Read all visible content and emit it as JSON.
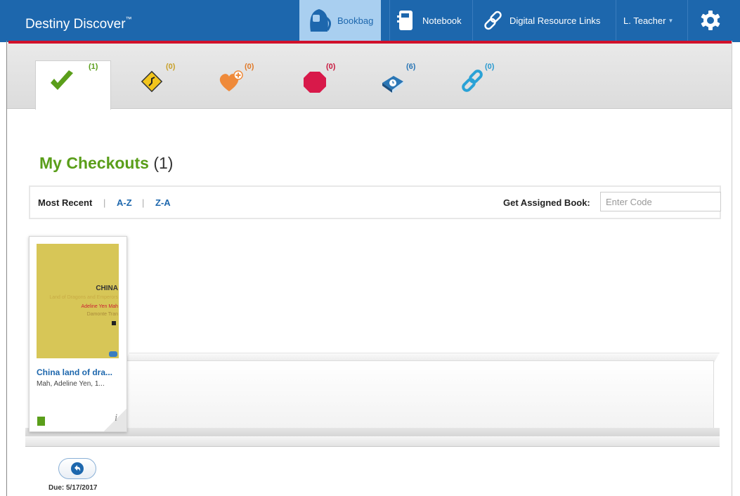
{
  "app": {
    "brand": "Destiny Discover",
    "tm": "™"
  },
  "nav": {
    "bookbag": "Bookbag",
    "notebook": "Notebook",
    "resource_links": "Digital Resource Links",
    "user": "L. Teacher"
  },
  "tabs": [
    {
      "icon": "checkmark-icon",
      "count": "(1)",
      "color": "#5a9e1a"
    },
    {
      "icon": "road-sign-icon",
      "count": "(0)",
      "color": "#c8a12a"
    },
    {
      "icon": "heart-plus-icon",
      "count": "(0)",
      "color": "#e07a2a"
    },
    {
      "icon": "stop-sign-icon",
      "count": "(0)",
      "color": "#c8193f"
    },
    {
      "icon": "book-clock-icon",
      "count": "(6)",
      "color": "#2a76b5"
    },
    {
      "icon": "link-icon",
      "count": "(0)",
      "color": "#2a9ad0"
    }
  ],
  "page": {
    "title": "My Checkouts",
    "count": "(1)"
  },
  "sort": {
    "most_recent": "Most Recent",
    "az": "A-Z",
    "za": "Z-A",
    "separator": "|"
  },
  "assigned": {
    "label": "Get Assigned Book:",
    "placeholder": "Enter Code"
  },
  "book": {
    "title": "China land of dra...",
    "author": "Mah, Adeline Yen, 1...",
    "cover_title": "CHINA",
    "cover_subtitle": "Land of Dragons and Emperors",
    "cover_author": "Adeline Yen Mah",
    "cover_illustrator": "Damonte Tran",
    "info": "i"
  },
  "due": "Due: 5/17/2017",
  "colors": {
    "topbar": "#1d67ad",
    "accent_red": "#d0112b",
    "title_green": "#5a9e1a"
  }
}
